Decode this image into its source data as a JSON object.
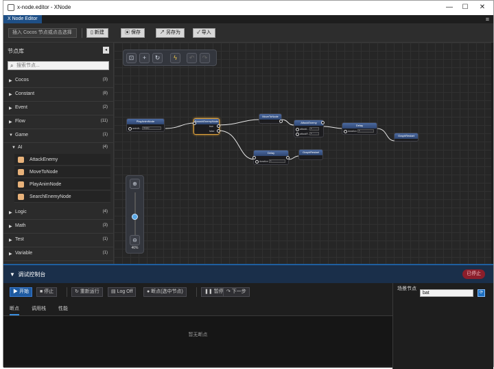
{
  "window": {
    "title": "x-node.editor - XNode",
    "min_glyph": "—",
    "max_glyph": "☐",
    "close_glyph": "✕"
  },
  "menubar": {
    "app_label": "X Node Editor",
    "menu_icon": "≡"
  },
  "toolbar": {
    "insert_label": "插入 Cocos 节点或点击选择",
    "new_label": "新建",
    "save_label": "保存",
    "save_as_label": "另存为",
    "import_label": "导入"
  },
  "sidebar": {
    "title": "节点库",
    "collapse_glyph": "◂",
    "search_placeholder": "搜索节点...",
    "categories_top": [
      {
        "name": "Cocos",
        "count": "(3)",
        "arrow": "▶"
      },
      {
        "name": "Constant",
        "count": "(8)",
        "arrow": "▶"
      },
      {
        "name": "Event",
        "count": "(2)",
        "arrow": "▶"
      },
      {
        "name": "Flow",
        "count": "(11)",
        "arrow": "▶"
      },
      {
        "name": "Game",
        "count": "(1)",
        "arrow": "▼"
      },
      {
        "name": "AI",
        "count": "(4)",
        "arrow": "▼"
      }
    ],
    "ai_nodes": [
      "AttackEnemy",
      "MoveToNode",
      "PlayAnimNode",
      "SearchEnemyNode"
    ],
    "categories_bottom": [
      {
        "name": "Logic",
        "count": "(4)",
        "arrow": "▶"
      },
      {
        "name": "Math",
        "count": "(3)",
        "arrow": "▶"
      },
      {
        "name": "Test",
        "count": "(1)",
        "arrow": "▶"
      },
      {
        "name": "Variable",
        "count": "(1)",
        "arrow": "▶"
      }
    ]
  },
  "canvas": {
    "tool_icons": [
      "fit-icon",
      "add-icon",
      "refresh-icon",
      "lightning-icon",
      "undo-icon",
      "redo-icon"
    ],
    "zoom_label": "46%",
    "zoom_level": 0.46,
    "nodes": {
      "play_anim": {
        "title": "PlayAnimNode",
        "row": "animN...",
        "value": "Happy"
      },
      "search_enemy": {
        "title": "SearchEnemyNode",
        "out1": "true",
        "out2": "false"
      },
      "move_to": {
        "title": "MoveToNode"
      },
      "attack_enemy": {
        "title": "AttackEnemy",
        "row1": "attackI...",
        "row2": "attackR...",
        "v1": "1",
        "v2": "1"
      },
      "delay_top": {
        "title": "Delay",
        "row": "duration",
        "v": "1"
      },
      "graph_restart_1": {
        "title": "GraphRestart"
      },
      "delay_bottom": {
        "title": "Delay",
        "row": "duration",
        "v": "1"
      },
      "graph_restart_2": {
        "title": "GraphRestart"
      }
    }
  },
  "debug": {
    "title": "调试控制台",
    "arrow": "▼",
    "status": "已停止",
    "buttons": {
      "start": "▶ 开始",
      "stop": "■ 停止",
      "rerun": "↻ 重新运行",
      "logoff": "Log Off",
      "breakpoint": "● 断点(选中节点)",
      "pause": "❚❚ 暂停",
      "step": "↷ 下一步"
    },
    "tabs": [
      "断点",
      "调用栈",
      "性能"
    ],
    "empty_text": "暂无断点",
    "scene_node_label": "场景节点",
    "scene_node_value": "bat",
    "go_icon": "⟳"
  }
}
